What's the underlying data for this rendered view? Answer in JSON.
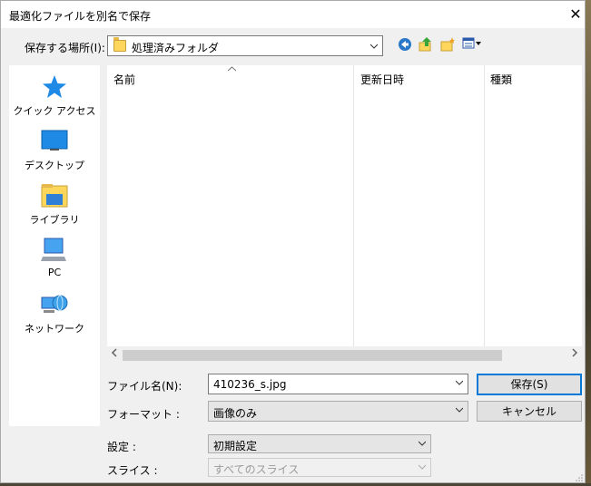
{
  "window": {
    "title": "最適化ファイルを別名で保存",
    "close_glyph": "✕"
  },
  "location": {
    "label": "保存する場所(I):",
    "value": "処理済みフォルダ"
  },
  "toolbar": [
    "back-icon",
    "up-folder-icon",
    "new-folder-icon",
    "view-menu-icon"
  ],
  "sidebar": {
    "items": [
      {
        "label": "クイック アクセス",
        "icon": "star-icon"
      },
      {
        "label": "デスクトップ",
        "icon": "desktop-icon"
      },
      {
        "label": "ライブラリ",
        "icon": "library-icon"
      },
      {
        "label": "PC",
        "icon": "pc-icon"
      },
      {
        "label": "ネットワーク",
        "icon": "network-icon"
      }
    ]
  },
  "columns": {
    "name": "名前",
    "modified": "更新日時",
    "type": "種類"
  },
  "form": {
    "filename_label": "ファイル名(N):",
    "filename_value": "410236_s.jpg",
    "format_label": "フォーマット :",
    "format_value": "画像のみ",
    "settings_label": "設定 :",
    "settings_value": "初期設定",
    "slices_label": "スライス :",
    "slices_value": "すべてのスライス"
  },
  "buttons": {
    "save": "保存(S)",
    "cancel": "キャンセル"
  },
  "colors": {
    "accent": "#0078d7",
    "folder": "#ffd65c"
  }
}
